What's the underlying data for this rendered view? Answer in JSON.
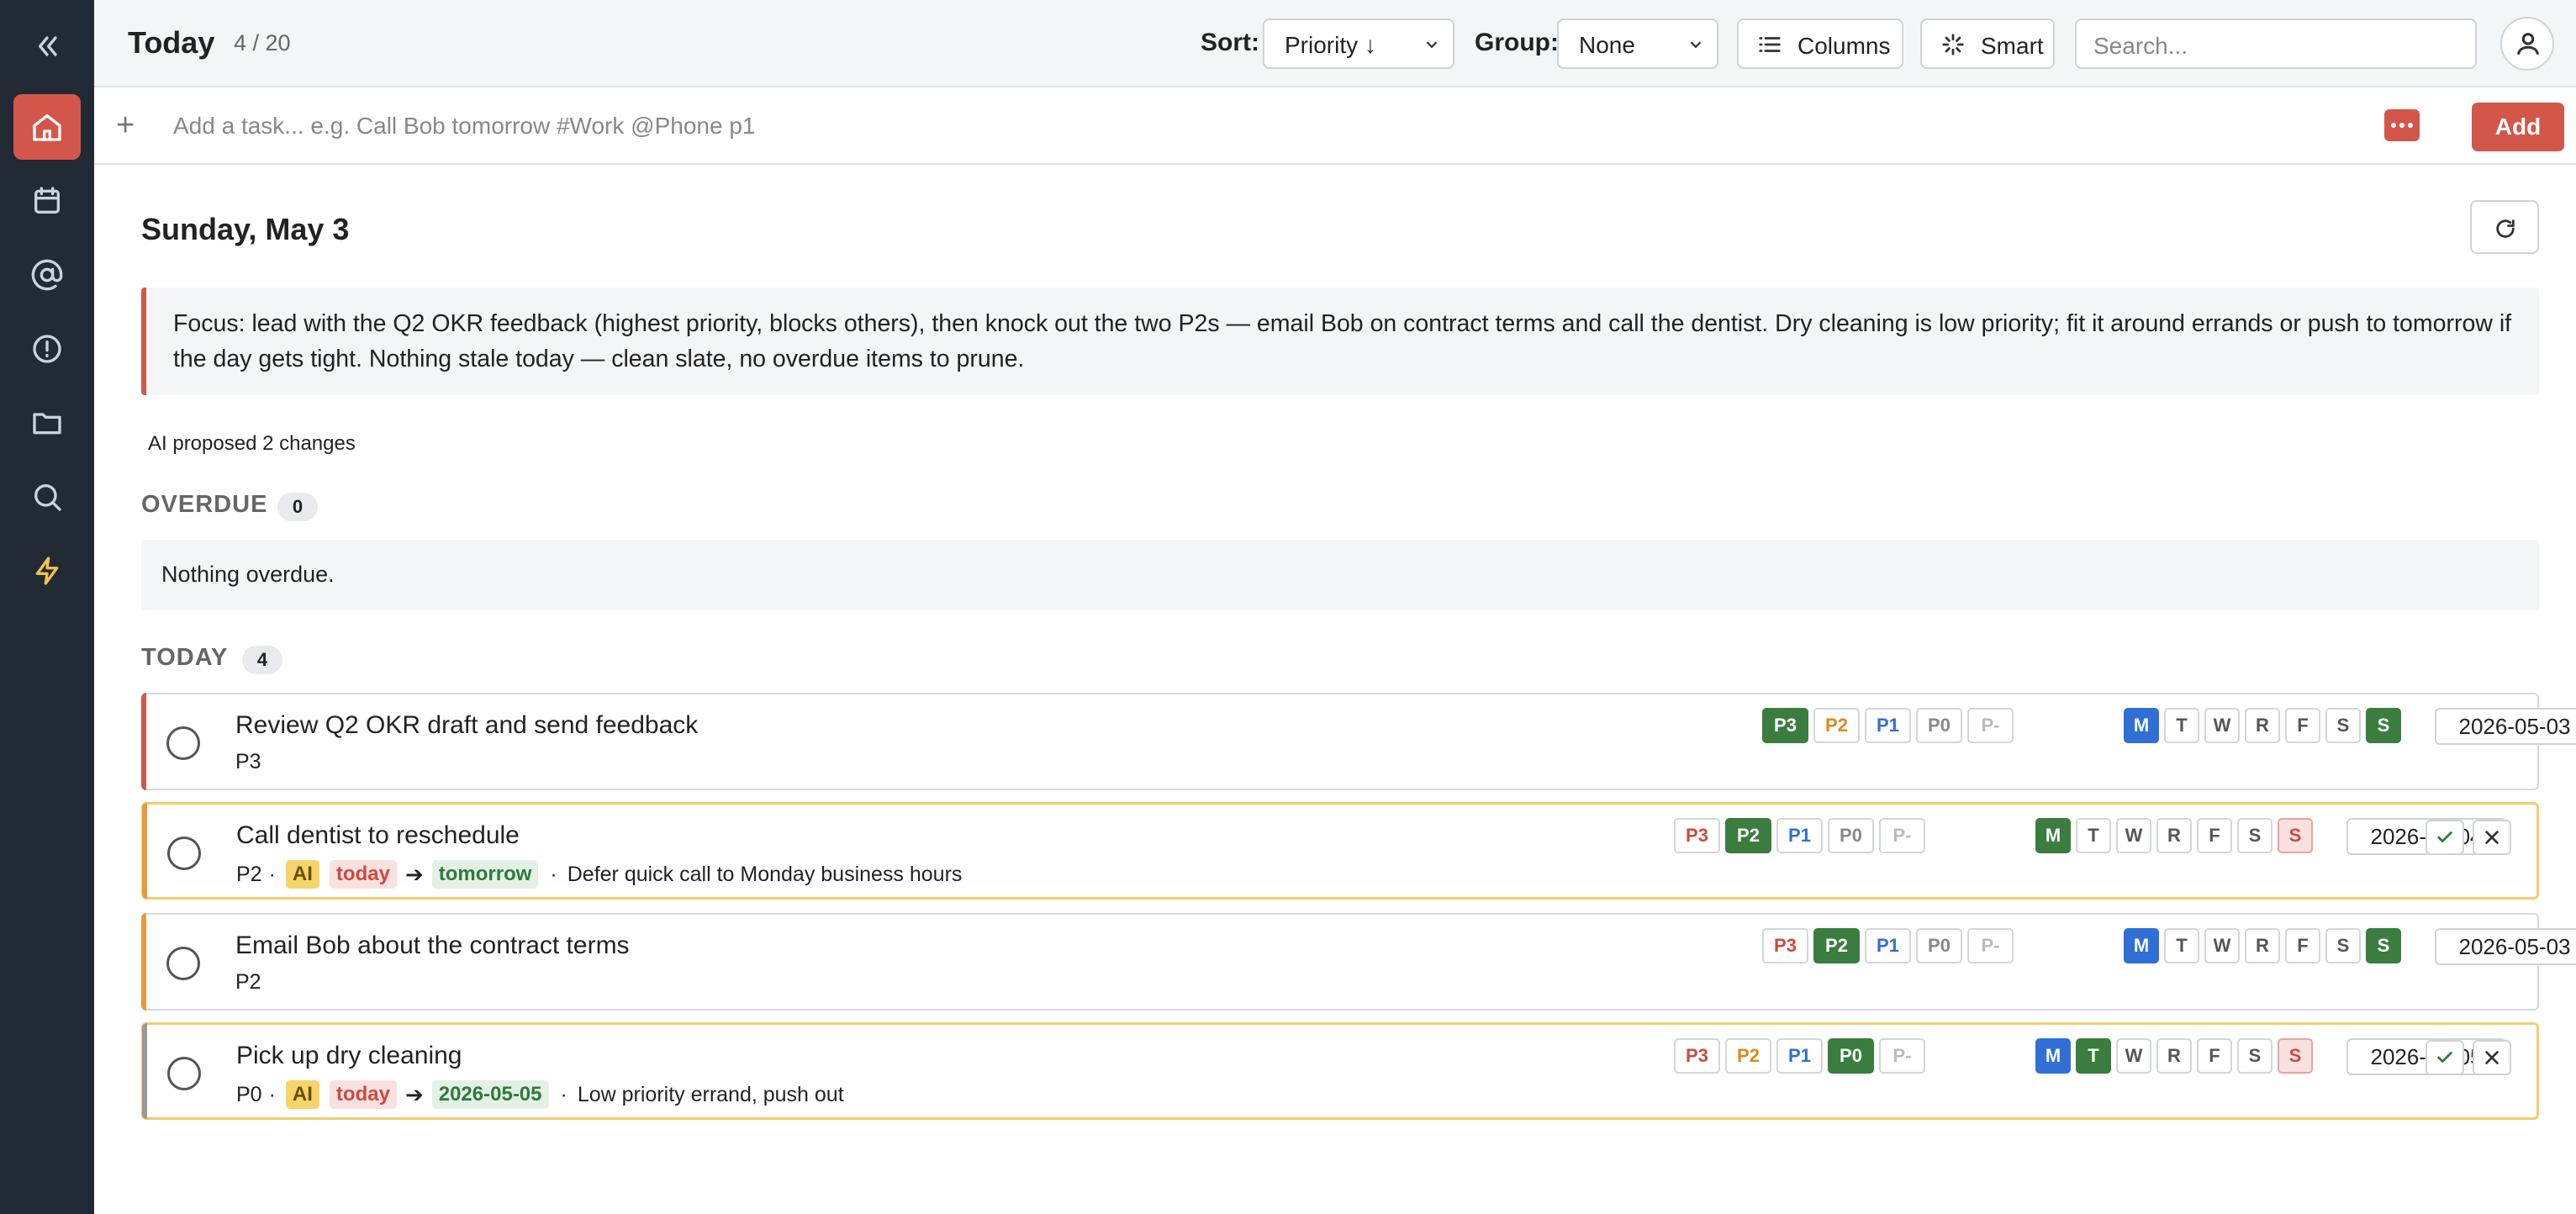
{
  "sidebar": {
    "items": [
      {
        "icon": "collapse-icon",
        "active": false
      },
      {
        "icon": "home-icon",
        "active": true
      },
      {
        "icon": "calendar-icon",
        "active": false
      },
      {
        "icon": "at-icon",
        "active": false
      },
      {
        "icon": "alert-icon",
        "active": false
      },
      {
        "icon": "folder-icon",
        "active": false
      },
      {
        "icon": "search-icon",
        "active": false
      },
      {
        "icon": "bolt-icon",
        "active": false
      }
    ]
  },
  "header": {
    "title": "Today",
    "count": "4 / 20",
    "sort_label": "Sort:",
    "sort_value": "Priority ↓",
    "group_label": "Group:",
    "group_value": "None",
    "columns_label": "Columns",
    "smart_label": "Smart",
    "search_placeholder": "Search..."
  },
  "addbar": {
    "placeholder": "Add a task... e.g. Call Bob tomorrow #Work @Phone p1",
    "add_label": "Add"
  },
  "main": {
    "date_heading": "Sunday, May 3",
    "focus_text": "Focus: lead with the Q2 OKR feedback (highest priority, blocks others), then knock out the two P2s — email Bob on contract terms and call the dentist. Dry cleaning is low priority; fit it around errands or push to tomorrow if the day gets tight. Nothing stale today — clean slate, no overdue items to prune.",
    "proposed_text": "AI proposed 2 changes",
    "overdue": {
      "label": "OVERDUE",
      "count": "0",
      "empty_text": "Nothing overdue."
    },
    "today": {
      "label": "TODAY",
      "count": "4"
    }
  },
  "priority_labels": [
    "P3",
    "P2",
    "P1",
    "P0",
    "P-"
  ],
  "day_labels": [
    "M",
    "T",
    "W",
    "R",
    "F",
    "S",
    "S"
  ],
  "colors": {
    "accent": "#d2574a",
    "green": "#3a7d3e",
    "blue": "#2f6fd6",
    "pending": "#f2cd6e"
  },
  "tasks": [
    {
      "name": "Review Q2 OKR draft and send feedback",
      "priority": "P3",
      "date": "2026-05-03",
      "pending": false
    },
    {
      "name": "Call dentist to reschedule",
      "priority": "P2",
      "date": "2026-05-04",
      "pending": true,
      "ai_label": "AI",
      "from": "today",
      "to": "tomorrow",
      "reason": "Defer quick call to Monday business hours"
    },
    {
      "name": "Email Bob about the contract terms",
      "priority": "P2",
      "date": "2026-05-03",
      "pending": false
    },
    {
      "name": "Pick up dry cleaning",
      "priority": "P0",
      "date": "2026-05-05",
      "pending": true,
      "ai_label": "AI",
      "from": "today",
      "to": "2026-05-05",
      "reason": "Low priority errand, push out"
    }
  ]
}
